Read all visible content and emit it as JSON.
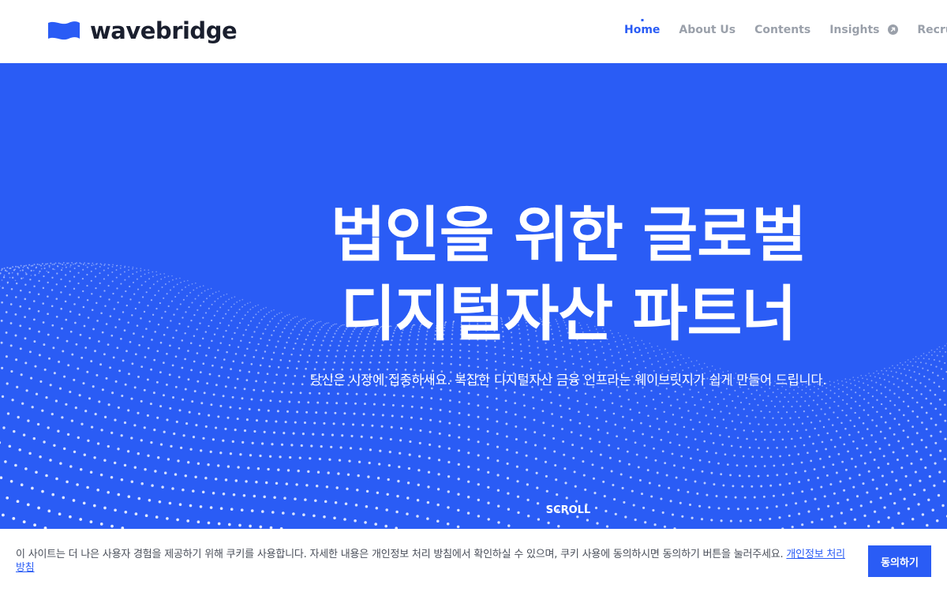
{
  "brand": {
    "name": "wavebridge",
    "accent_color": "#2a5cf5",
    "logo_icon": "wave-flag-icon"
  },
  "nav": {
    "items": [
      {
        "label": "Home",
        "active": true
      },
      {
        "label": "About Us",
        "active": false
      },
      {
        "label": "Contents",
        "active": false
      },
      {
        "label": "Insights",
        "active": false,
        "icon": "external-link-icon"
      },
      {
        "label": "Recruit",
        "active": false
      }
    ]
  },
  "hero": {
    "title_line1": "법인을 위한 글로벌",
    "title_line2": "디지털자산 파트너",
    "subtitle": "당신은 시장에 집중하세요. 복잡한 디지털자산 금융 인프라는 웨이브릿지가 쉽게 만들어 드립니다.",
    "scroll_label": "SCROLL",
    "background_color": "#2a5cf5"
  },
  "cookie": {
    "message": "이 사이트는 더 나은 사용자 경험을 제공하기 위해 쿠키를 사용합니다. 자세한 내용은 개인정보 처리 방침에서 확인하실 수 있으며, 쿠키 사용에 동의하시면 동의하기 버튼을 눌러주세요. ",
    "link_label": "개인정보 처리 방침",
    "agree_label": "동의하기"
  }
}
